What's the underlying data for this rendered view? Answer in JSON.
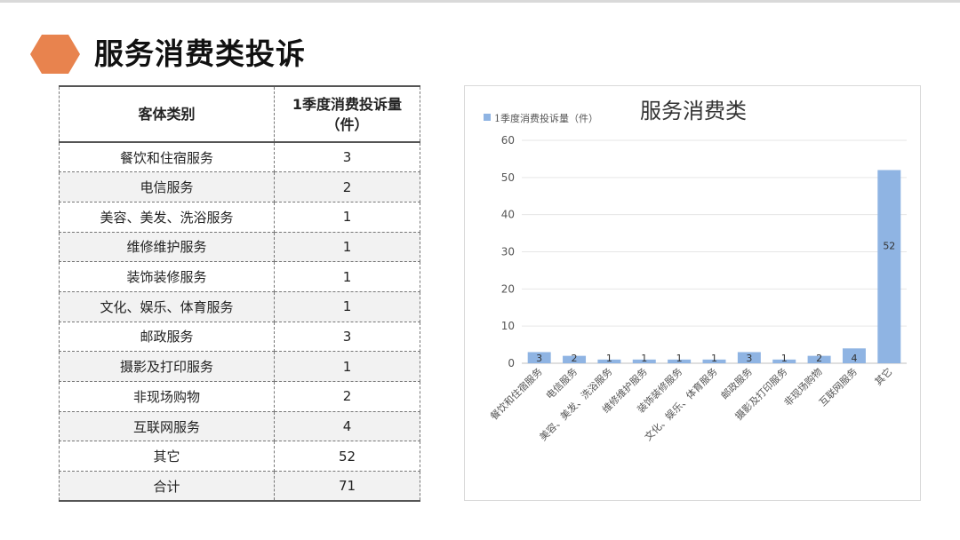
{
  "page": {
    "title": "服务消费类投诉"
  },
  "table": {
    "headers": [
      "客体类别",
      "1季度消费投诉量（件）"
    ],
    "rows": [
      [
        "餐饮和住宿服务",
        "3"
      ],
      [
        "电信服务",
        "2"
      ],
      [
        "美容、美发、洗浴服务",
        "1"
      ],
      [
        "维修维护服务",
        "1"
      ],
      [
        "装饰装修服务",
        "1"
      ],
      [
        "文化、娱乐、体育服务",
        "1"
      ],
      [
        "邮政服务",
        "3"
      ],
      [
        "摄影及打印服务",
        "1"
      ],
      [
        "非现场购物",
        "2"
      ],
      [
        "互联网服务",
        "4"
      ],
      [
        "其它",
        "52"
      ],
      [
        "合计",
        "71"
      ]
    ]
  },
  "chart_data": {
    "type": "bar",
    "title": "服务消费类",
    "categories": [
      "餐饮和住宿服务",
      "电信服务",
      "美容、美发、洗浴服务",
      "维修维护服务",
      "装饰装修服务",
      "文化、娱乐、体育服务",
      "邮政服务",
      "摄影及打印服务",
      "非现场购物",
      "互联网服务",
      "其它"
    ],
    "series": [
      {
        "name": "1季度消费投诉量（件）",
        "values": [
          3,
          2,
          1,
          1,
          1,
          1,
          3,
          1,
          2,
          4,
          52
        ]
      }
    ],
    "ylim": [
      0,
      60
    ],
    "yticks": [
      0,
      10,
      20,
      30,
      40,
      50,
      60
    ],
    "grid": true,
    "legend": "top-left",
    "data_labels": true,
    "bar_color": "#8fb4e3",
    "accent_color": "#e8834e"
  }
}
